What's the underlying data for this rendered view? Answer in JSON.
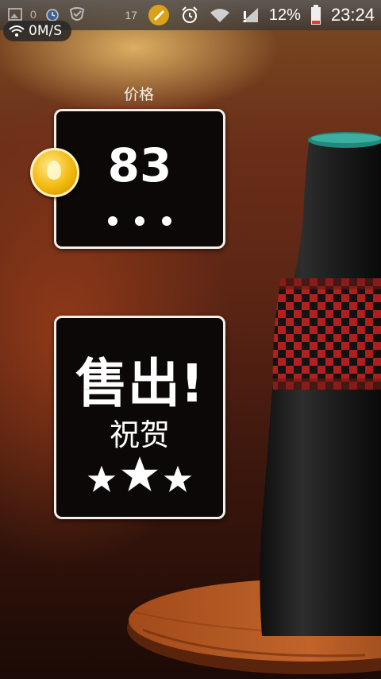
{
  "status_bar": {
    "left_icons": [
      "image-icon",
      "alarm-icon",
      "shield-icon"
    ],
    "left_number": "0",
    "notification_count": "17",
    "battery_percent": "12%",
    "time": "23:24",
    "right_icons": [
      "game-notification-icon",
      "alarm-clock-icon",
      "wifi-icon",
      "signal-icon",
      "battery-icon"
    ]
  },
  "net_speed": "0M/S",
  "price": {
    "label": "价格",
    "value": "83",
    "coin_icon": "gold-coin-icon"
  },
  "sold": {
    "title": "售出!",
    "subtitle": "祝贺",
    "stars": 3
  },
  "colors": {
    "panel_bg": "#0c0807",
    "panel_border": "#f2efe9",
    "vase_dark": "#1a1a1a",
    "vase_pattern_red": "#c2201c",
    "vase_rim_teal": "#1f8a7c",
    "table_wood": "#8a3e16"
  }
}
